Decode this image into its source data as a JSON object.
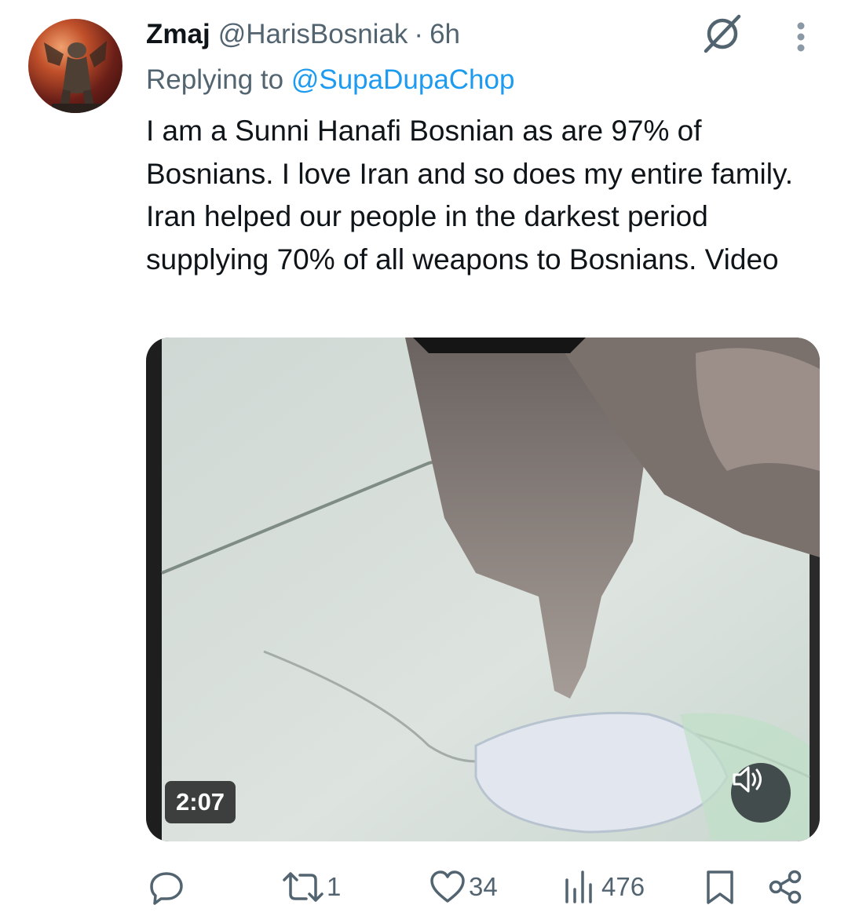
{
  "tweet": {
    "author_name": "Zmaj",
    "author_handle": "@HarisBosniak",
    "separator": "·",
    "time": "6h",
    "replying_prefix": "Replying to",
    "replying_to": "@SupaDupaChop",
    "text": "I am a Sunni Hanafi Bosnian as are 97% of Bosnians. I love Iran and so does my entire family. Iran helped our people in the darkest period supplying 70% of all weapons to Bosnians. Video"
  },
  "media": {
    "type": "video",
    "duration": "2:07",
    "muted": true
  },
  "actions": {
    "reply_count": "",
    "retweet_count": "1",
    "like_count": "34",
    "views_count": "476"
  },
  "icons": {
    "grok": "grok-icon",
    "more": "more-vertical-icon",
    "reply": "reply-icon",
    "retweet": "retweet-icon",
    "like": "heart-icon",
    "views": "views-chart-icon",
    "bookmark": "bookmark-icon",
    "share": "share-icon",
    "mute": "speaker-muted-icon"
  },
  "colors": {
    "link": "#1d9bf0",
    "secondary_text": "#536471",
    "primary_text": "#0f1419"
  }
}
